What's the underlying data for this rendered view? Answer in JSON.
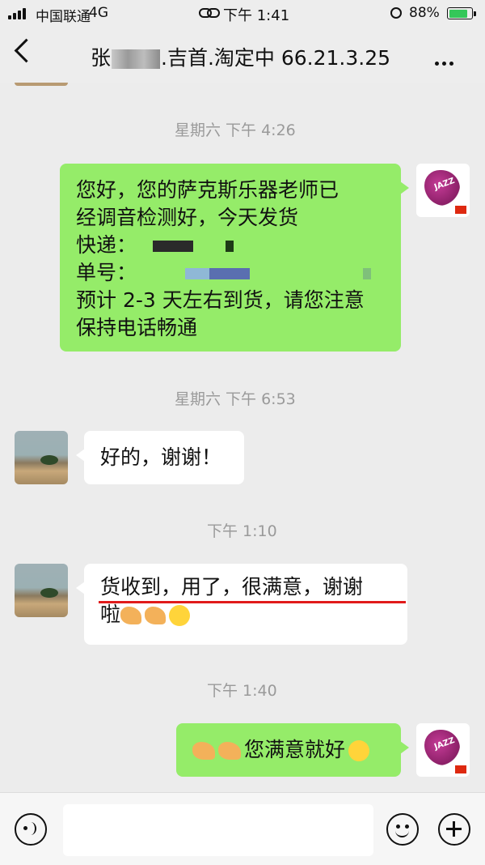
{
  "status_bar": {
    "carrier": "中国联通",
    "network": "4G",
    "time": "下午 1:41",
    "battery": "88%",
    "battery_level": 0.88
  },
  "nav": {
    "title_prefix": "张",
    "title_suffix": ".吉首.淘定中 66.21.3.25"
  },
  "messages": {
    "ts1": "星期六 下午 4:26",
    "m1": {
      "l1": "您好，您的萨克斯乐器老师已",
      "l2": "经调音检测好，今天发货",
      "l3": "快递：",
      "l4": "单号：",
      "l5": "预计 2-3 天左右到货，请您注意",
      "l6": "保持电话畅通"
    },
    "ts2": "星期六 下午 6:53",
    "m2": "好的，谢谢！",
    "ts3": "下午 1:10",
    "m3": {
      "l1": "货收到，用了，很满意，谢谢",
      "l2": "啦"
    },
    "ts4": "下午 1:40",
    "m4": "您满意就好"
  },
  "colors": {
    "sent_bubble": "#95ec69",
    "received_bubble": "#ffffff",
    "background": "#ececec",
    "underline": "#e11b1b"
  },
  "icons": {
    "back": "chevron-left-icon",
    "more": "more-icon",
    "voice": "voice-icon",
    "emoji": "emoji-icon",
    "add": "plus-icon"
  }
}
